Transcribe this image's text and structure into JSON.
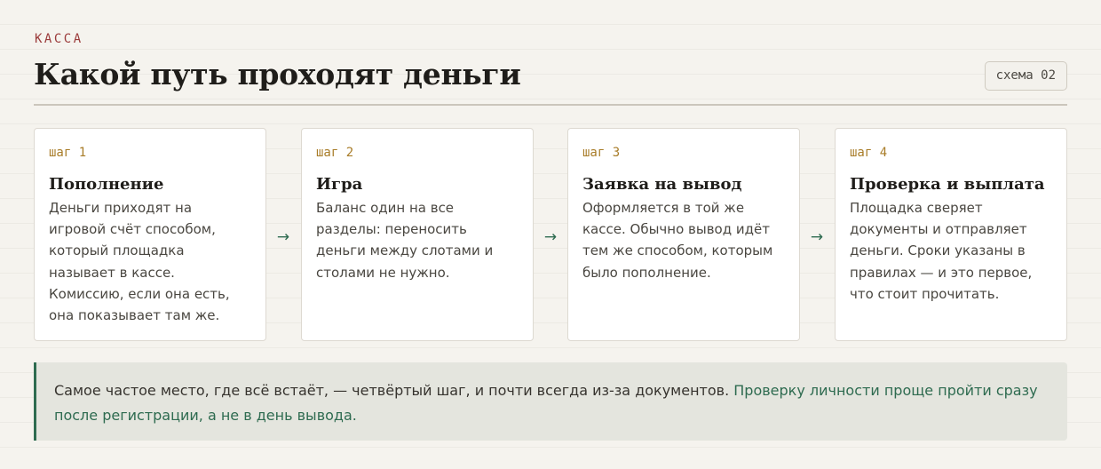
{
  "header": {
    "eyebrow": "КАССА",
    "title": "Какой путь проходят деньги",
    "badge": "схема 02"
  },
  "steps": [
    {
      "label": "шаг 1",
      "title": "Пополнение",
      "text": "Деньги приходят на игровой счёт способом, который площадка называет в кассе. Комиссию, если она есть, она показывает там же."
    },
    {
      "label": "шаг 2",
      "title": "Игра",
      "text": "Баланс один на все разделы: переносить деньги между слотами и столами не нужно."
    },
    {
      "label": "шаг 3",
      "title": "Заявка на вывод",
      "text": "Оформляется в той же кассе. Обычно вывод идёт тем же способом, которым было пополнение."
    },
    {
      "label": "шаг 4",
      "title": "Проверка и выплата",
      "text": "Площадка сверяет документы и отправляет деньги. Сроки указаны в правилах — и это первое, что стоит прочитать."
    }
  ],
  "arrows": [
    "→",
    "→",
    "→"
  ],
  "note": {
    "text": "Самое частое место, где всё встаёт, — четвёртый шаг, и почти всегда из-за документов. ",
    "highlight": "Проверку личности проще пройти сразу после регистрации, а не в день вывода."
  },
  "colors": {
    "accent": "#2e6b50",
    "eyebrow": "#9b3b3b",
    "step_label": "#a87c28",
    "background": "#f5f3ee"
  },
  "icons": {
    "arrow": "arrow-right-icon"
  }
}
